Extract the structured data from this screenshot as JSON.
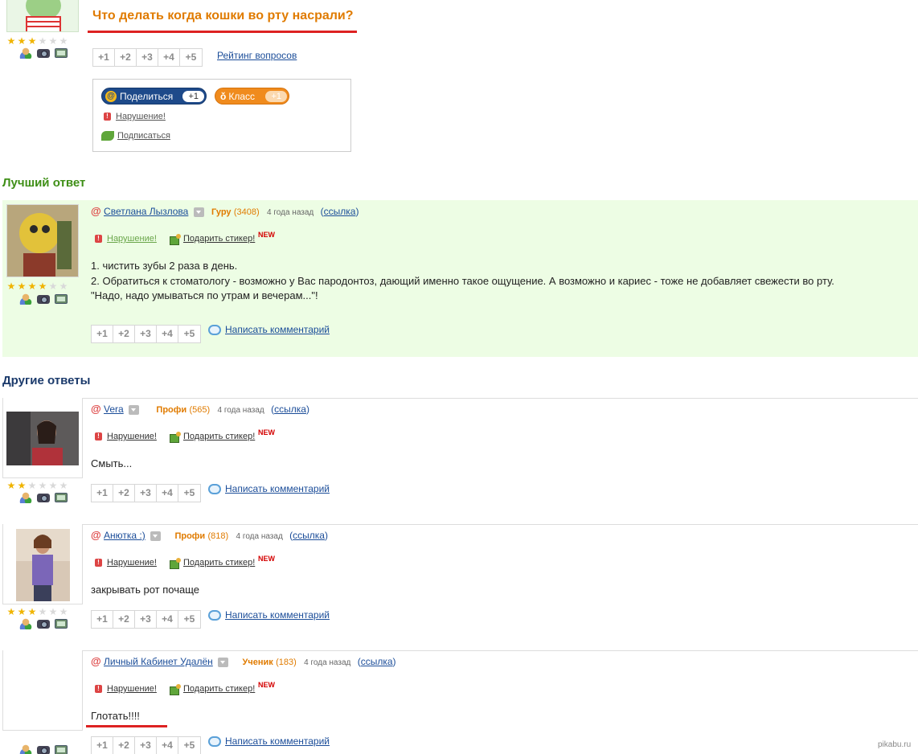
{
  "question": {
    "title": "Что делать когда кошки во рту насрали?",
    "stars": 3,
    "votes": [
      "+1",
      "+2",
      "+3",
      "+4",
      "+5"
    ],
    "rating_link": "Рейтинг вопросов",
    "share": {
      "label": "Поделиться",
      "count": "+1"
    },
    "klass": {
      "label": "Класс",
      "count": "+1"
    },
    "violation": "Нарушение!",
    "subscribe": "Подписаться"
  },
  "best_answer": {
    "section_title": "Лучший ответ",
    "author": "Светлана Лызлова",
    "rank": "Гуру",
    "score": "(3408)",
    "time": "4 года назад",
    "link_open": "(",
    "link": "ссылка",
    "link_close": ")",
    "stars": 4,
    "violation": "Нарушение!",
    "sticker": "Подарить стикер!",
    "new": "NEW",
    "text_lines": [
      "1. чистить зубы 2 раза в день.",
      "2. Обратиться к стоматологу - возможно у Вас пародонтоз, дающий именно такое ощущение. А возможно и кариес - тоже не добавляет свежести во рту.",
      "\"Надо, надо умываться по утрам и вечерам...\"!"
    ],
    "votes": [
      "+1",
      "+2",
      "+3",
      "+4",
      "+5"
    ],
    "comment": "Написать комментарий"
  },
  "other_answers": {
    "section_title": "Другие ответы",
    "items": [
      {
        "author": "Vera",
        "rank": "Профи",
        "score": "(565)",
        "time": "4 года назад",
        "link": "ссылка",
        "stars": 2,
        "violation": "Нарушение!",
        "sticker": "Подарить стикер!",
        "new": "NEW",
        "text": "Смыть...",
        "votes": [
          "+1",
          "+2",
          "+3",
          "+4",
          "+5"
        ],
        "comment": "Написать комментарий"
      },
      {
        "author": "Анютка :)",
        "rank": "Профи",
        "score": "(818)",
        "time": "4 года назад",
        "link": "ссылка",
        "stars": 3,
        "violation": "Нарушение!",
        "sticker": "Подарить стикер!",
        "new": "NEW",
        "text": "закрывать рот почаще",
        "votes": [
          "+1",
          "+2",
          "+3",
          "+4",
          "+5"
        ],
        "comment": "Написать комментарий"
      },
      {
        "author": "Личный Кабинет Удалён",
        "rank": "Ученик",
        "score": "(183)",
        "time": "4 года назад",
        "link": "ссылка",
        "stars": 0,
        "violation": "Нарушение!",
        "sticker": "Подарить стикер!",
        "new": "NEW",
        "text": "Глотать!!!!",
        "votes": [
          "+1",
          "+2",
          "+3",
          "+4",
          "+5"
        ],
        "comment": "Написать комментарий"
      }
    ]
  },
  "watermark": "pikabu.ru",
  "colors": {
    "title_orange": "#e07b00",
    "best_green": "#3f8f17",
    "best_bg": "#edfde4",
    "other_title": "#1b3a6b",
    "link": "#1b4d99",
    "underline_red": "#dd2222"
  }
}
